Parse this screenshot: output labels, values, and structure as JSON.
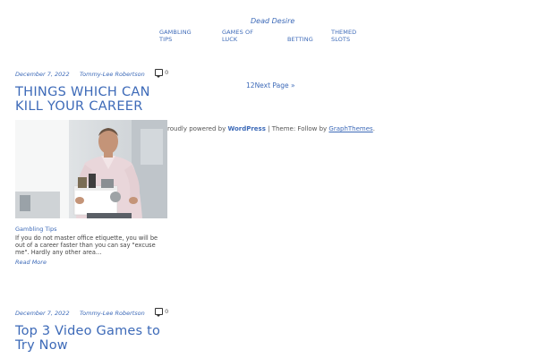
{
  "site": {
    "title": "Dead Desire"
  },
  "nav": {
    "items": [
      {
        "label": "GAMBLING TIPS"
      },
      {
        "label": "GAMES OF LUCK"
      },
      {
        "label": "BETTING"
      },
      {
        "label": "THEMED SLOTS"
      }
    ]
  },
  "posts": [
    {
      "date": "December 7, 2022",
      "author": "Tommy-Lee Robertson",
      "comments": "0",
      "title": "THINGS WHICH CAN KILL YOUR CAREER",
      "category": "Gambling Tips",
      "excerpt": "If you do not master office etiquette, you will be out of a career faster than you can say \"excuse me\". Hardly any other area…",
      "read_more": "Read More"
    },
    {
      "date": "December 7, 2022",
      "author": "Tommy-Lee Robertson",
      "comments": "0",
      "title": "Top 3 Video Games to Try Now"
    }
  ],
  "pagination": {
    "page1": "1",
    "page2": "2",
    "next": "Next Page »"
  },
  "footer": {
    "prefix": "roudly powered by ",
    "wp_link": "WordPress",
    "middle": " | Theme: Follow by ",
    "theme_link": "GraphThemes",
    "suffix": "."
  },
  "colors": {
    "link": "#3d6ab8",
    "text": "#444444"
  },
  "icons": {
    "comments": "comment-bubble-icon"
  }
}
